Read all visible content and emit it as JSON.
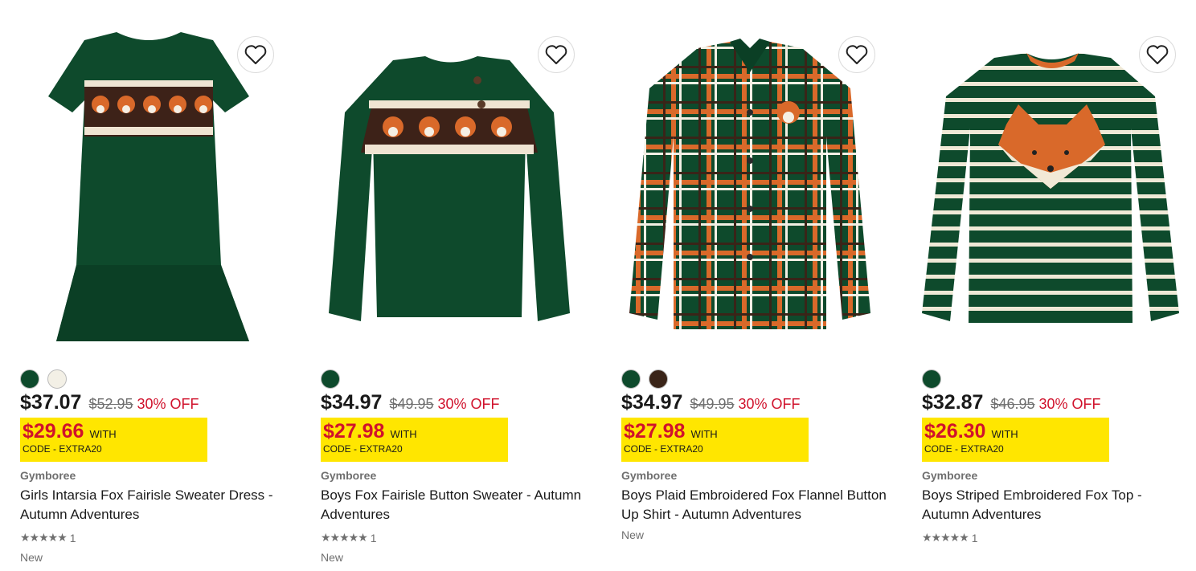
{
  "products": [
    {
      "brand": "Gymboree",
      "title": "Girls Intarsia Fox Fairisle Sweater Dress - Autumn Adventures",
      "price": "$37.07",
      "original_price": "$52.95",
      "discount": "30% OFF",
      "promo_price": "$29.66",
      "promo_with": "WITH",
      "promo_code": "CODE - EXTRA20",
      "rating_count": "1",
      "rating_value": 5,
      "badge": "New",
      "swatches": [
        "#0e4a2c",
        "#f3f0e6"
      ],
      "image_icon": "sweater-dress-image"
    },
    {
      "brand": "Gymboree",
      "title": "Boys Fox Fairisle Button Sweater - Autumn Adventures",
      "price": "$34.97",
      "original_price": "$49.95",
      "discount": "30% OFF",
      "promo_price": "$27.98",
      "promo_with": "WITH",
      "promo_code": "CODE - EXTRA20",
      "rating_count": "1",
      "rating_value": 5,
      "badge": "New",
      "swatches": [
        "#0e4a2c"
      ],
      "image_icon": "sweater-image"
    },
    {
      "brand": "Gymboree",
      "title": "Boys Plaid Embroidered Fox Flannel Button Up Shirt - Autumn Adventures",
      "price": "$34.97",
      "original_price": "$49.95",
      "discount": "30% OFF",
      "promo_price": "$27.98",
      "promo_with": "WITH",
      "promo_code": "CODE - EXTRA20",
      "rating_count": null,
      "rating_value": null,
      "badge": "New",
      "swatches": [
        "#0e4a2c",
        "#3a2418"
      ],
      "image_icon": "plaid-shirt-image"
    },
    {
      "brand": "Gymboree",
      "title": "Boys Striped Embroidered Fox Top - Autumn Adventures",
      "price": "$32.87",
      "original_price": "$46.95",
      "discount": "30% OFF",
      "promo_price": "$26.30",
      "promo_with": "WITH",
      "promo_code": "CODE - EXTRA20",
      "rating_count": "1",
      "rating_value": 5,
      "badge": null,
      "swatches": [
        "#0e4a2c"
      ],
      "image_icon": "striped-top-image"
    }
  ],
  "colors": {
    "accent_red": "#d0122c",
    "promo_yellow": "#ffe600",
    "garment_green": "#0e4a2c",
    "fox_orange": "#d9692a"
  }
}
